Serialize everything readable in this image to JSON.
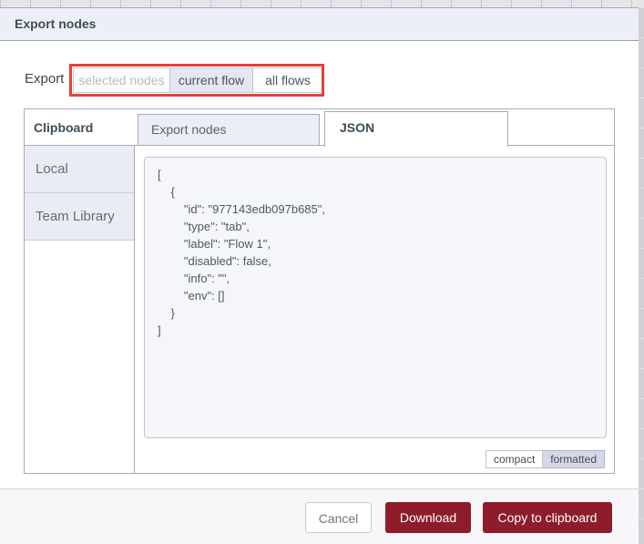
{
  "dialog": {
    "title": "Export nodes",
    "export_row": {
      "label": "Export",
      "options": [
        {
          "label": "selected nodes",
          "state": "disabled"
        },
        {
          "label": "current flow",
          "state": "selected"
        },
        {
          "label": "all flows",
          "state": "normal"
        }
      ],
      "annotation_color": "#e2423a"
    },
    "tabs_panel": {
      "panel_label": "Clipboard",
      "tabs": [
        {
          "label": "Export nodes",
          "active": false
        },
        {
          "label": "JSON",
          "active": true
        }
      ],
      "sidebar": {
        "items": [
          {
            "label": "Local"
          },
          {
            "label": "Team Library"
          }
        ]
      },
      "editor": {
        "content": "[\n    {\n        \"id\": \"977143edb097b685\",\n        \"type\": \"tab\",\n        \"label\": \"Flow 1\",\n        \"disabled\": false,\n        \"info\": \"\",\n        \"env\": []\n    }\n]",
        "format_buttons": [
          {
            "label": "compact",
            "selected": false
          },
          {
            "label": "formatted",
            "selected": true
          }
        ]
      }
    },
    "footer": {
      "buttons": [
        {
          "label": "Cancel",
          "style": "secondary"
        },
        {
          "label": "Download",
          "style": "primary"
        },
        {
          "label": "Copy to clipboard",
          "style": "primary"
        }
      ]
    },
    "colors": {
      "primary_button": "#8e1c2b",
      "header_bg": "#edeff8",
      "annotation_red": "#e2423a"
    }
  }
}
